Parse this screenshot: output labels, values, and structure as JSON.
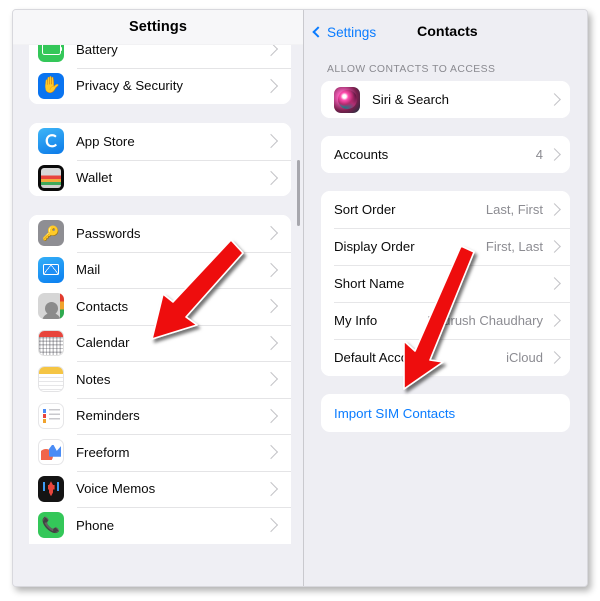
{
  "left_panel": {
    "header_title": "Settings",
    "groups": [
      {
        "id": "group-system",
        "clip_top": true,
        "rows": [
          {
            "label": "Battery",
            "icon": "battery-icon",
            "icon_class": "battery"
          },
          {
            "label": "Privacy & Security",
            "icon": "hand-privacy-icon",
            "icon_class": "privacy"
          }
        ]
      },
      {
        "id": "group-store",
        "rows": [
          {
            "label": "App Store",
            "icon": "app-store-icon",
            "icon_class": "appstore"
          },
          {
            "label": "Wallet",
            "icon": "wallet-icon",
            "icon_class": "wallet"
          }
        ]
      },
      {
        "id": "group-apps",
        "clip_bottom": true,
        "rows": [
          {
            "label": "Passwords",
            "icon": "passwords-key-icon",
            "icon_class": "passwords"
          },
          {
            "label": "Mail",
            "icon": "mail-icon",
            "icon_class": "mail"
          },
          {
            "label": "Contacts",
            "icon": "contacts-icon",
            "icon_class": "contacts"
          },
          {
            "label": "Calendar",
            "icon": "calendar-icon",
            "icon_class": "calendar"
          },
          {
            "label": "Notes",
            "icon": "notes-icon",
            "icon_class": "notes"
          },
          {
            "label": "Reminders",
            "icon": "reminders-icon",
            "icon_class": "reminders"
          },
          {
            "label": "Freeform",
            "icon": "freeform-icon",
            "icon_class": "freeform"
          },
          {
            "label": "Voice Memos",
            "icon": "voice-memos-icon",
            "icon_class": "voicememos"
          },
          {
            "label": "Phone",
            "icon": "phone-icon",
            "icon_class": "phone"
          }
        ]
      }
    ]
  },
  "right_panel": {
    "back_label": "Settings",
    "title": "Contacts",
    "section_header": "ALLOW CONTACTS TO ACCESS",
    "access_rows": [
      {
        "label": "Siri & Search",
        "value": "",
        "icon": "siri-icon",
        "icon_class": "siri"
      }
    ],
    "accounts_rows": [
      {
        "label": "Accounts",
        "value": "4"
      }
    ],
    "settings_rows": [
      {
        "label": "Sort Order",
        "value": "Last, First"
      },
      {
        "label": "Display Order",
        "value": "First, Last"
      },
      {
        "label": "Short Name",
        "value": ""
      },
      {
        "label": "My Info",
        "value": "Paurush  Chaudhary"
      },
      {
        "label": "Default Account",
        "value": "iCloud"
      }
    ],
    "import_link": "Import SIM Contacts"
  },
  "annotations": {
    "accent_color": "#ee1111",
    "arrow_1_target": "Contacts",
    "arrow_2_target": "Default Account"
  },
  "colors": {
    "tint_blue": "#0a7cff",
    "background": "#eeeef3",
    "card": "#ffffff",
    "separator": "#e6e6e8",
    "secondary_text": "#8c8c92"
  }
}
